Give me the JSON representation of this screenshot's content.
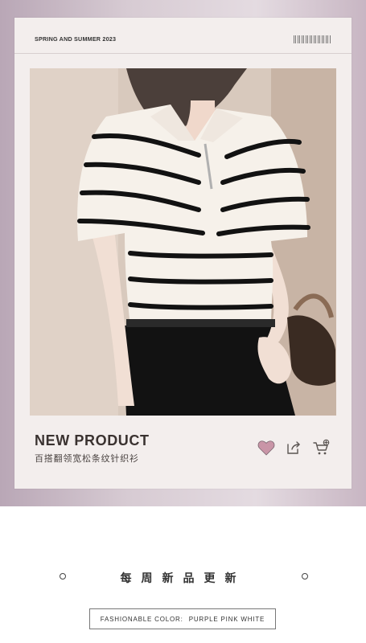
{
  "card": {
    "season": "SPRING AND SUMMER 2023",
    "product_title": "NEW PRODUCT",
    "product_subtitle": "百搭翻领宽松条纹针织衫"
  },
  "actions": {
    "icons": [
      "heart-icon",
      "share-icon",
      "add-to-cart-icon"
    ]
  },
  "footer": {
    "tagline": "每周新品更新",
    "color_label": "FASHIONABLE COLOR:",
    "color_values": "PURPLE PINK WHITE"
  },
  "colors": {
    "background_band": "#d7cbd3",
    "card": "#f3eeed",
    "heart": "#c995a7",
    "text_dark": "#3a3230"
  }
}
